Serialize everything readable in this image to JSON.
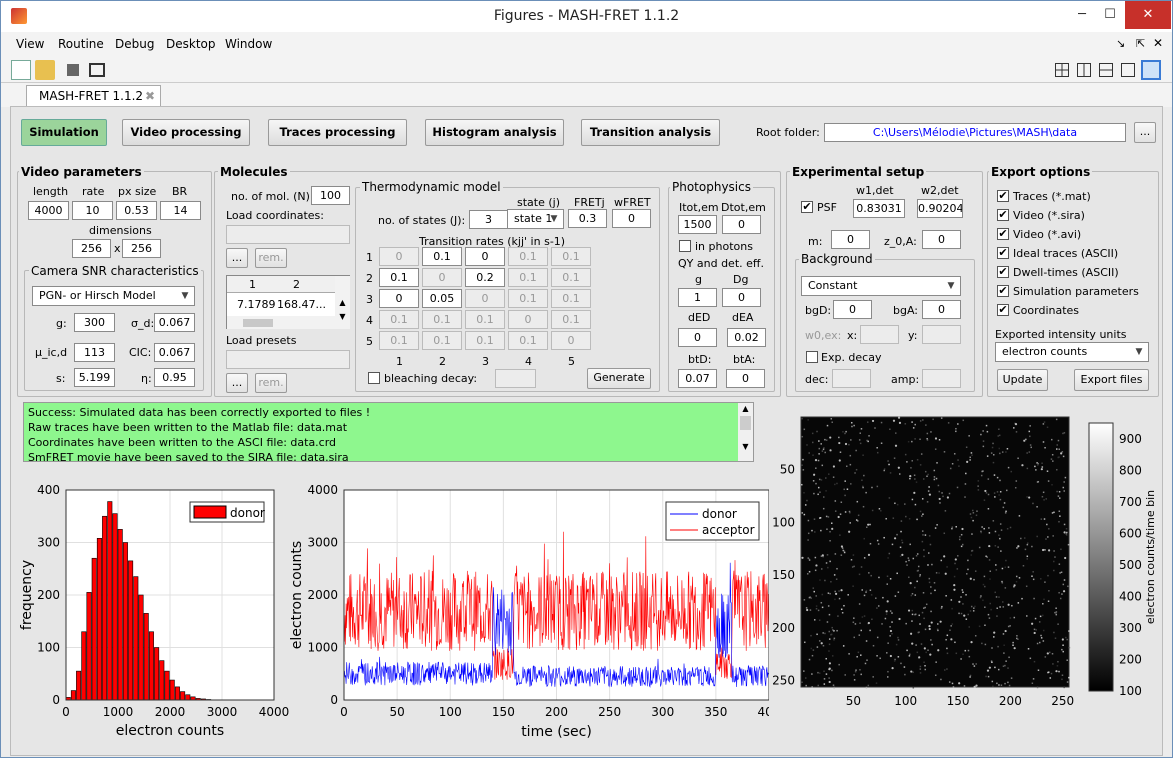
{
  "window": {
    "title": "Figures - MASH-FRET 1.1.2",
    "min": "─",
    "max": "☐",
    "close": "✕"
  },
  "menus": [
    "View",
    "Routine",
    "Debug",
    "Desktop",
    "Window"
  ],
  "tab": {
    "label": "MASH-FRET 1.1.2",
    "close": "✖"
  },
  "modules": [
    "Simulation",
    "Video processing",
    "Traces processing",
    "Histogram analysis",
    "Transition analysis"
  ],
  "root": {
    "label": "Root folder:",
    "path": "C:\\Users\\Mélodie\\Pictures\\MASH\\data",
    "browse": "..."
  },
  "video": {
    "title": "Video parameters",
    "length_l": "length",
    "rate_l": "rate",
    "px_l": "px size",
    "br_l": "BR",
    "length": "4000",
    "rate": "10",
    "px": "0.53",
    "br": "14",
    "dim_l": "dimensions",
    "dim_x": "256",
    "dim_times": "x",
    "dim_y": "256"
  },
  "camera": {
    "title": "Camera SNR characteristics",
    "model": "PGN- or Hirsch Model",
    "g_l": "g:",
    "g": "300",
    "sd_l": "σ_d:",
    "sd": "0.067",
    "mu_l": "μ_ic,d",
    "mu": "113",
    "cic_l": "CIC:",
    "cic": "0.067",
    "s_l": "s:",
    "s": "5.199",
    "eta_l": "η:",
    "eta": "0.95"
  },
  "molecules": {
    "title": "Molecules",
    "nmol_l": "no. of mol. (N):",
    "nmol": "100",
    "coords_l": "Load coordinates:",
    "browse": "...",
    "rem": "rem.",
    "col1": "1",
    "col2": "2",
    "v1": "7.1789",
    "v2": "168.47...",
    "presets_l": "Load presets"
  },
  "thermo": {
    "title": "Thermodynamic model",
    "nstates_l": "no. of states (J):",
    "nstates": "3",
    "statej_l": "state (j)",
    "statej": "state 1",
    "fretj_l": "FRETj",
    "fretj": "0.3",
    "wfret_l": "wFRET",
    "wfret": "0",
    "rates_l": "Transition rates (kjj' in s-1)",
    "rows": [
      [
        "0",
        "0.1",
        "0",
        "0.1",
        "0.1"
      ],
      [
        "0.1",
        "0",
        "0.2",
        "0.1",
        "0.1"
      ],
      [
        "0",
        "0.05",
        "0",
        "0.1",
        "0.1"
      ],
      [
        "0.1",
        "0.1",
        "0.1",
        "0",
        "0.1"
      ],
      [
        "0.1",
        "0.1",
        "0.1",
        "0.1",
        "0"
      ]
    ],
    "rowlabels": [
      "1",
      "2",
      "3",
      "4",
      "5"
    ],
    "collabels": [
      "1",
      "2",
      "3",
      "4",
      "5"
    ],
    "bleach_l": "bleaching decay:",
    "generate": "Generate"
  },
  "photo": {
    "title": "Photophysics",
    "itot_l": "Itot,em",
    "dtot_l": "Dtot,em",
    "itot": "1500",
    "dtot": "0",
    "inph_l": "in photons",
    "qy_l": "QY and det. eff.",
    "g_l": "g",
    "dg_l": "Dg",
    "g": "1",
    "dg": "0",
    "ded_l": "dED",
    "dea_l": "dEA",
    "ded": "0",
    "dea": "0.02",
    "btd_l": "btD:",
    "bta_l": "btA:",
    "btd": "0.07",
    "bta": "0"
  },
  "exp": {
    "title": "Experimental setup",
    "w1_l": "w1,det",
    "w2_l": "w2,det",
    "psf_l": "PSF",
    "w1": "0.83031",
    "w2": "0.90204",
    "m_l": "m:",
    "m": "0",
    "z0_l": "z_0,A:",
    "z0": "0",
    "bg_title": "Background",
    "bg_type": "Constant",
    "bgd_l": "bgD:",
    "bgd": "0",
    "bga_l": "bgA:",
    "bga": "0",
    "w0_l": "w0,ex:",
    "x_l": "x:",
    "y_l": "y:",
    "expdecay_l": "Exp. decay",
    "dec_l": "dec:",
    "amp_l": "amp:"
  },
  "export": {
    "title": "Export options",
    "items": [
      "Traces (*.mat)",
      "Video (*.sira)",
      "Video (*.avi)",
      "Ideal traces (ASCII)",
      "Dwell-times (ASCII)",
      "Simulation parameters",
      "Coordinates"
    ],
    "units_l": "Exported intensity units",
    "units": "electron counts",
    "update": "Update",
    "export": "Export files"
  },
  "log": [
    "Success: Simulated data has been correctly exported to files !",
    "Raw traces have been written to the Matlab file: data.mat",
    "Coordinates have been written to the ASCI file: data.crd",
    "SmFRET movie have been saved to the SIRA file: data.sira"
  ],
  "chart_data": [
    {
      "type": "bar",
      "title": "",
      "xlabel": "electron counts",
      "ylabel": "frequency",
      "xlim": [
        0,
        4000
      ],
      "ylim": [
        0,
        400
      ],
      "xticks": [
        "0",
        "1000",
        "2000",
        "3000",
        "4000"
      ],
      "yticks": [
        "0",
        "100",
        "200",
        "300",
        "400"
      ],
      "series": [
        {
          "name": "donor",
          "color": "#ff0000"
        }
      ],
      "x": [
        100,
        200,
        300,
        400,
        500,
        600,
        700,
        800,
        900,
        1000,
        1100,
        1200,
        1300,
        1400,
        1500,
        1600,
        1700,
        1800,
        1900,
        2000,
        2100,
        2200,
        2300,
        2400,
        2500,
        2600,
        2700,
        2800
      ],
      "values": [
        5,
        18,
        55,
        130,
        205,
        270,
        308,
        350,
        378,
        355,
        325,
        300,
        265,
        235,
        200,
        165,
        130,
        100,
        75,
        55,
        38,
        25,
        16,
        10,
        6,
        3,
        2,
        1
      ]
    },
    {
      "type": "line",
      "title": "",
      "xlabel": "time (sec)",
      "ylabel": "electron counts",
      "xlim": [
        0,
        400
      ],
      "ylim": [
        0,
        4000
      ],
      "xticks": [
        "0",
        "50",
        "100",
        "150",
        "200",
        "250",
        "300",
        "350",
        "400"
      ],
      "yticks": [
        "0",
        "1000",
        "2000",
        "3000",
        "4000"
      ],
      "series": [
        {
          "name": "donor",
          "color": "#0000ff",
          "segments": [
            [
              0,
              140,
              500
            ],
            [
              140,
              160,
              1500
            ],
            [
              160,
              350,
              450
            ],
            [
              350,
              365,
              1400
            ],
            [
              365,
              400,
              450
            ]
          ]
        },
        {
          "name": "acceptor",
          "color": "#ff0000",
          "segments": [
            [
              0,
              140,
              1700
            ],
            [
              140,
              160,
              700
            ],
            [
              160,
              350,
              1700
            ],
            [
              350,
              365,
              700
            ],
            [
              365,
              400,
              1700
            ]
          ]
        }
      ]
    },
    {
      "type": "heatmap",
      "title": "",
      "xlim": [
        1,
        256
      ],
      "ylim": [
        1,
        256
      ],
      "xticks": [
        "50",
        "100",
        "150",
        "200",
        "250"
      ],
      "yticks": [
        "50",
        "100",
        "150",
        "200",
        "250"
      ],
      "colorbar": {
        "label": "electron counts/time bin",
        "ticks": [
          "100",
          "200",
          "300",
          "400",
          "500",
          "600",
          "700",
          "800",
          "900"
        ],
        "range": [
          100,
          950
        ]
      }
    }
  ]
}
